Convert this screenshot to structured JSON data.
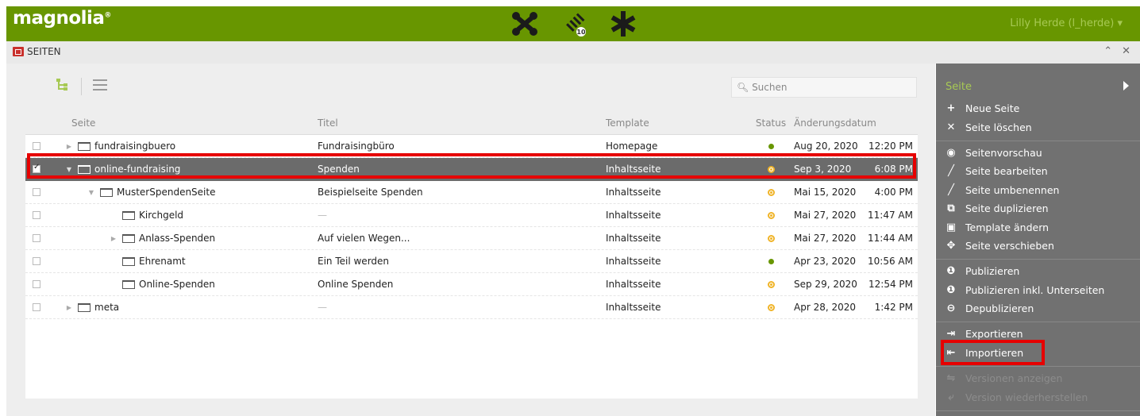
{
  "brand": {
    "logo_text": "magnolia",
    "logo_mark": "®",
    "accent": "#689600"
  },
  "header": {
    "notification_count": "10",
    "user_label": "Lilly Herde (l_herde) ▾"
  },
  "app": {
    "title": "SEITEN",
    "search_placeholder": "Suchen"
  },
  "grid": {
    "columns": [
      "Seite",
      "Titel",
      "Template",
      "Status",
      "Änderungsdatum"
    ],
    "rows": [
      {
        "name": "fundraisingbuero",
        "title": "Fundraisingbüro",
        "template": "Homepage",
        "status": "published",
        "date": "Aug 20, 2020",
        "time": "12:20 PM",
        "checked": false,
        "level": 0,
        "expand": "collapsed"
      },
      {
        "name": "online-fundraising",
        "title": "Spenden",
        "template": "Inhaltsseite",
        "status": "modified",
        "date": "Sep 3, 2020",
        "time": "6:08 PM",
        "checked": true,
        "level": 0,
        "expand": "expanded",
        "selected": true
      },
      {
        "name": "MusterSpendenSeite",
        "title": "Beispielseite Spenden",
        "template": "Inhaltsseite",
        "status": "modified",
        "date": "Mai 15, 2020",
        "time": "4:00 PM",
        "checked": false,
        "level": 1,
        "expand": "expanded"
      },
      {
        "name": "Kirchgeld",
        "title": "—",
        "template": "Inhaltsseite",
        "status": "modified",
        "date": "Mai 27, 2020",
        "time": "11:47 AM",
        "checked": false,
        "level": 2,
        "expand": "none"
      },
      {
        "name": "Anlass-Spenden",
        "title": "Auf vielen Wegen...",
        "template": "Inhaltsseite",
        "status": "modified",
        "date": "Mai 27, 2020",
        "time": "11:44 AM",
        "checked": false,
        "level": 2,
        "expand": "collapsed"
      },
      {
        "name": "Ehrenamt",
        "title": "Ein Teil werden",
        "template": "Inhaltsseite",
        "status": "published",
        "date": "Apr 23, 2020",
        "time": "10:56 AM",
        "checked": false,
        "level": 2,
        "expand": "none"
      },
      {
        "name": "Online-Spenden",
        "title": "Online Spenden",
        "template": "Inhaltsseite",
        "status": "modified",
        "date": "Sep 29, 2020",
        "time": "12:54 PM",
        "checked": false,
        "level": 2,
        "expand": "none"
      },
      {
        "name": "meta",
        "title": "—",
        "template": "Inhaltsseite",
        "status": "modified",
        "date": "Apr 28, 2020",
        "time": "1:42 PM",
        "checked": false,
        "level": 0,
        "expand": "collapsed"
      }
    ]
  },
  "actions": {
    "title": "Seite",
    "groups": [
      [
        {
          "label": "Neue Seite",
          "icon": "plus-icon",
          "glyph": "+"
        },
        {
          "label": "Seite löschen",
          "icon": "close-icon",
          "glyph": "✕"
        }
      ],
      [
        {
          "label": "Seitenvorschau",
          "icon": "eye-icon",
          "glyph": "◉"
        },
        {
          "label": "Seite bearbeiten",
          "icon": "pencil-icon",
          "glyph": "╱"
        },
        {
          "label": "Seite umbenennen",
          "icon": "pencil-icon",
          "glyph": "╱"
        },
        {
          "label": "Seite duplizieren",
          "icon": "duplicate-icon",
          "glyph": "⧉"
        },
        {
          "label": "Template ändern",
          "icon": "template-icon",
          "glyph": "▣"
        },
        {
          "label": "Seite verschieben",
          "icon": "move-icon",
          "glyph": "✥"
        }
      ],
      [
        {
          "label": "Publizieren",
          "icon": "publish-icon",
          "glyph": "❶"
        },
        {
          "label": "Publizieren inkl. Unterseiten",
          "icon": "publish-subpages-icon",
          "glyph": "❶"
        },
        {
          "label": "Depublizieren",
          "icon": "unpublish-icon",
          "glyph": "⊖"
        }
      ],
      [
        {
          "label": "Exportieren",
          "icon": "export-icon",
          "glyph": "⇥"
        },
        {
          "label": "Importieren",
          "icon": "import-icon",
          "glyph": "⇤"
        }
      ],
      [
        {
          "label": "Versionen anzeigen",
          "icon": "versions-icon",
          "glyph": "⇋",
          "disabled": true
        },
        {
          "label": "Version wiederherstellen",
          "icon": "restore-version-icon",
          "glyph": "⤶",
          "disabled": true
        }
      ]
    ]
  }
}
